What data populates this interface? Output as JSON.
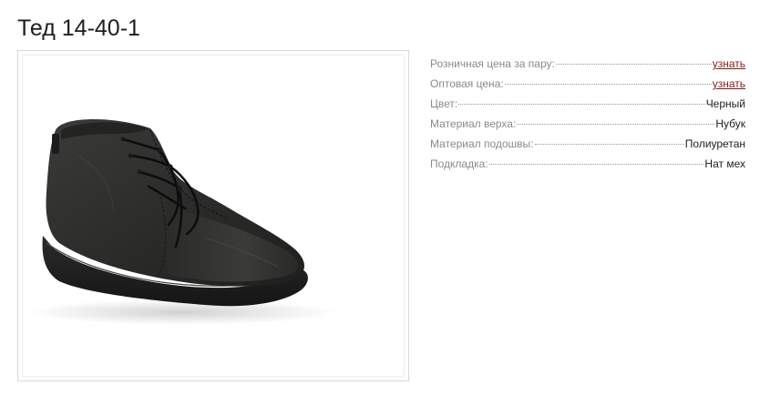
{
  "product": {
    "title": "Тед 14-40-1",
    "image_subject": "shoe-boot-photo"
  },
  "specs": [
    {
      "label": "Розничная цена за пару:",
      "value": "узнать",
      "is_link": true
    },
    {
      "label": "Оптовая цена:",
      "value": "узнать",
      "is_link": true
    },
    {
      "label": "Цвет:",
      "value": "Черный",
      "is_link": false
    },
    {
      "label": "Материал верха:",
      "value": "Нубук",
      "is_link": false
    },
    {
      "label": "Материал подошвы:",
      "value": "Полиуретан",
      "is_link": false
    },
    {
      "label": "Подкладка:",
      "value": "Нат мех",
      "is_link": false
    }
  ],
  "colors": {
    "link": "#8b1a1a",
    "label": "#8a8a8a",
    "value": "#1e1e1e",
    "frame_border": "#d8d8d8"
  }
}
